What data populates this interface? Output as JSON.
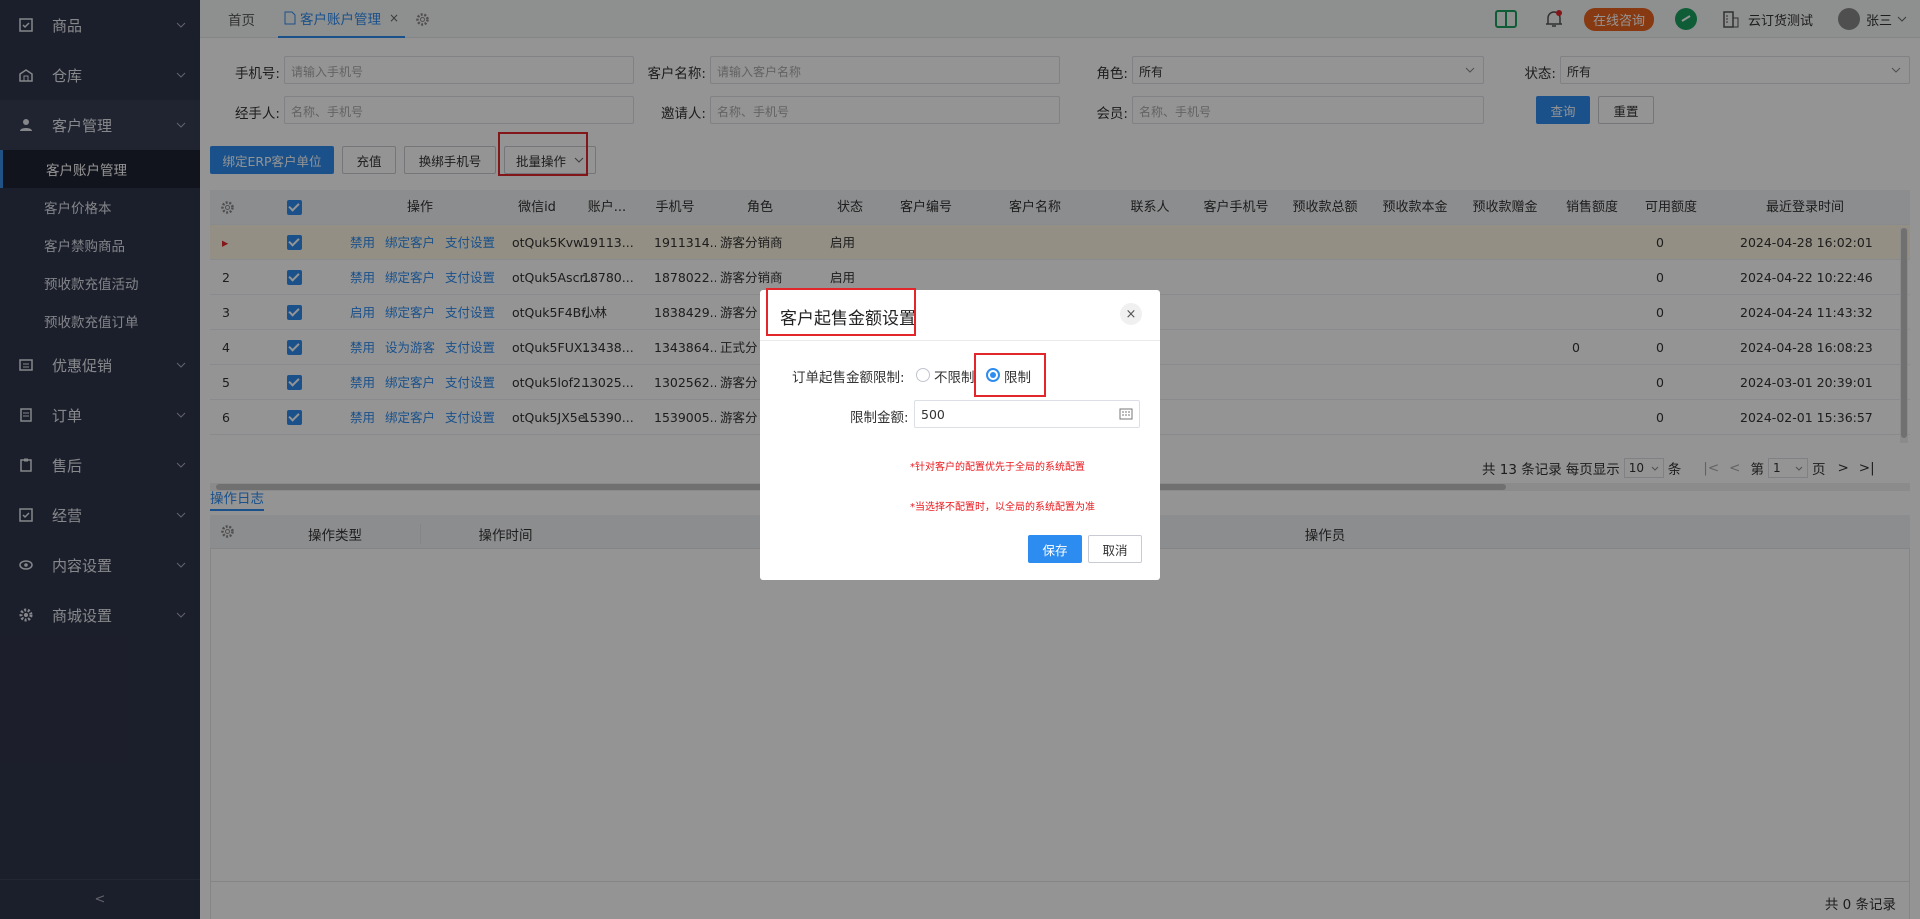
{
  "sidebar": {
    "groups": [
      {
        "label": "商品",
        "icon": "checkbox-square-icon"
      },
      {
        "label": "仓库",
        "icon": "warehouse-icon"
      },
      {
        "label": "客户管理",
        "icon": "user-icon"
      },
      {
        "label": "优惠促销",
        "icon": "coupon-icon"
      },
      {
        "label": "订单",
        "icon": "order-icon"
      },
      {
        "label": "售后",
        "icon": "clipboard-icon"
      },
      {
        "label": "经营",
        "icon": "checkbox-square-icon"
      },
      {
        "label": "内容设置",
        "icon": "eye-icon"
      },
      {
        "label": "商城设置",
        "icon": "gear-icon"
      }
    ],
    "sub_items": [
      "客户账户管理",
      "客户价格本",
      "客户禁购商品",
      "预收款充值活动",
      "预收款充值订单"
    ],
    "collapse": "<"
  },
  "topbar": {
    "tabs": [
      "首页",
      "客户账户管理"
    ],
    "tab_close": "×",
    "consult_label": "在线咨询",
    "company": "云订货测试",
    "user": "张三"
  },
  "filters": {
    "phone_label": "手机号:",
    "phone_placeholder": "请输入手机号",
    "name_label": "客户名称:",
    "name_placeholder": "请输入客户名称",
    "role_label": "角色:",
    "role_value": "所有",
    "status_label": "状态:",
    "status_value": "所有",
    "handler_label": "经手人:",
    "handler_placeholder": "名称、手机号",
    "inviter_label": "邀请人:",
    "inviter_placeholder": "名称、手机号",
    "member_label": "会员:",
    "member_placeholder": "名称、手机号",
    "query": "查询",
    "reset": "重置"
  },
  "toolbar": {
    "bind_erp": "绑定ERP客户单位",
    "recharge": "充值",
    "change_phone": "换绑手机号",
    "batch": "批量操作"
  },
  "table": {
    "headers": [
      "操作",
      "微信id",
      "账户...",
      "手机号",
      "角色",
      "状态",
      "客户编号",
      "客户名称",
      "联系人",
      "客户手机号",
      "预收款总额",
      "预收款本金",
      "预收款赠金",
      "销售额度",
      "可用额度",
      "最近登录时间"
    ],
    "rows": [
      {
        "no": "▸",
        "actions": [
          "禁用",
          "绑定客户",
          "支付设置"
        ],
        "wechat": "otQuk5Kvw...",
        "account": "19113...",
        "phone": "1911314...",
        "role": "游客分销商",
        "status": "启用",
        "sales": "",
        "avail": "0",
        "login": "2024-04-28 16:02:01"
      },
      {
        "no": "2",
        "actions": [
          "禁用",
          "绑定客户",
          "支付设置"
        ],
        "wechat": "otQuk5Ascr...",
        "account": "18780...",
        "phone": "1878022...",
        "role": "游客分销商",
        "status": "启用",
        "sales": "",
        "avail": "0",
        "login": "2024-04-22 10:22:46"
      },
      {
        "no": "3",
        "actions": [
          "启用",
          "绑定客户",
          "支付设置"
        ],
        "wechat": "otQuk5F4Bf...",
        "account": "小林",
        "phone": "1838429...",
        "role": "游客分",
        "status": "",
        "sales": "",
        "avail": "0",
        "login": "2024-04-24 11:43:32"
      },
      {
        "no": "4",
        "actions": [
          "禁用",
          "设为游客",
          "支付设置"
        ],
        "wechat": "otQuk5FUX...",
        "account": "13438...",
        "phone": "1343864...",
        "role": "正式分",
        "status": "",
        "sales": "0",
        "avail": "0",
        "login": "2024-04-28 16:08:23"
      },
      {
        "no": "5",
        "actions": [
          "禁用",
          "绑定客户",
          "支付设置"
        ],
        "wechat": "otQuk5lof2...",
        "account": "13025...",
        "phone": "1302562...",
        "role": "游客分",
        "status": "",
        "sales": "",
        "avail": "0",
        "login": "2024-03-01 20:39:01"
      },
      {
        "no": "6",
        "actions": [
          "禁用",
          "绑定客户",
          "支付设置"
        ],
        "wechat": "otQuk5JX5e...",
        "account": "15390...",
        "phone": "1539005...",
        "role": "游客分",
        "status": "",
        "sales": "",
        "avail": "0",
        "login": "2024-02-01 15:36:57"
      }
    ]
  },
  "pager": {
    "total": "共 13 条记录",
    "per_page_label": "每页显示",
    "per_page": "10",
    "unit": "条",
    "page_prefix": "第",
    "page": "1",
    "page_suffix": "页"
  },
  "log": {
    "tab": "操作日志",
    "headers": [
      "操作类型",
      "操作时间",
      "操作员"
    ],
    "total": "共 0 条记录"
  },
  "dialog": {
    "title": "客户起售金额设置",
    "close": "×",
    "limit_label": "订单起售金额限制:",
    "option_unlimited": "不限制",
    "option_limit": "限制",
    "amount_label": "限制金额:",
    "amount_value": "500",
    "note1": "*针对客户的配置优先于全局的系统配置",
    "note2": "*当选择不配置时，以全局的系统配置为准",
    "save": "保存",
    "cancel": "取消"
  }
}
